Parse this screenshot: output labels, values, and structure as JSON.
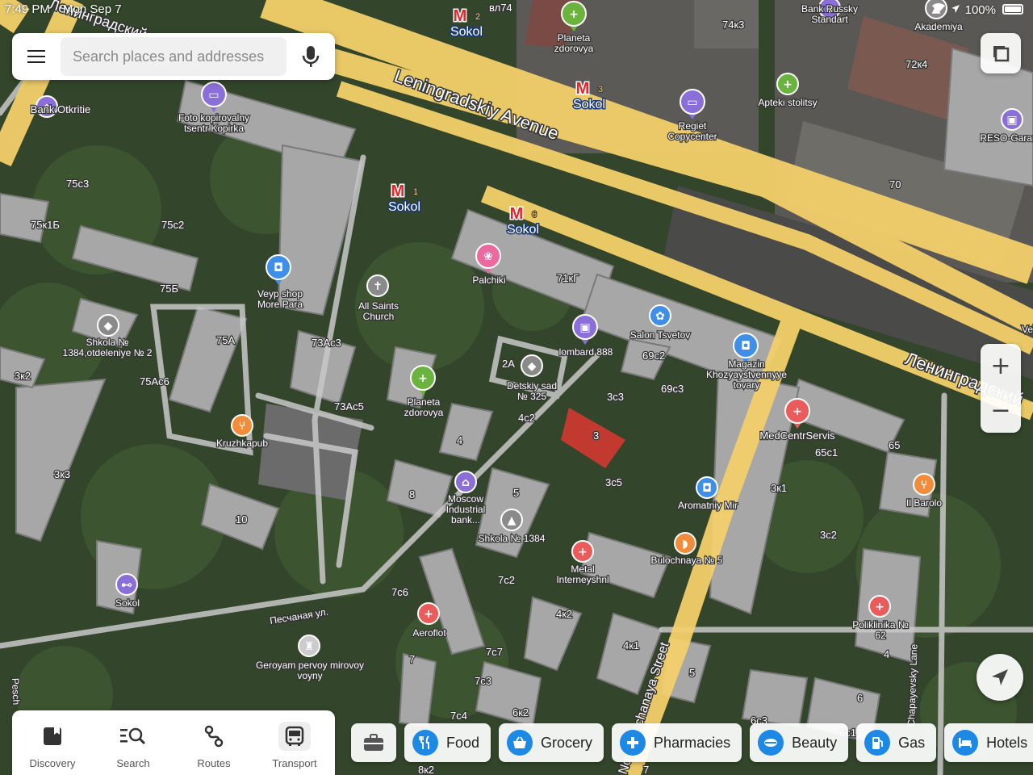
{
  "status": {
    "time": "7:49 PM",
    "date": "Mon Sep 7",
    "battery": "100%"
  },
  "search": {
    "placeholder": "Search places and addresses"
  },
  "zoom": {
    "in": "+",
    "out": "−"
  },
  "tabs": [
    {
      "label": "Discovery",
      "icon": "bookmark-icon"
    },
    {
      "label": "Search",
      "icon": "search-list-icon"
    },
    {
      "label": "Routes",
      "icon": "routes-icon"
    },
    {
      "label": "Transport",
      "icon": "bus-icon"
    }
  ],
  "chips": [
    {
      "label": "Food",
      "icon": "fork-knife-icon"
    },
    {
      "label": "Grocery",
      "icon": "basket-icon"
    },
    {
      "label": "Pharmacies",
      "icon": "cross-icon"
    },
    {
      "label": "Beauty",
      "icon": "beauty-icon"
    },
    {
      "label": "Gas",
      "icon": "fuel-icon"
    },
    {
      "label": "Hotels",
      "icon": "bed-icon"
    }
  ],
  "colors": {
    "major_road": "#f3cf6a",
    "minor_road": "#cfcfcf",
    "metro": "#e3262c",
    "poi_pharmacy": "#6bb33f",
    "poi_service": "#8a6fd8",
    "poi_shop": "#3f8fe8",
    "poi_food": "#f08c3a",
    "poi_medical": "#ea5b5b",
    "poi_beauty": "#ea6aa0",
    "chip_accent": "#1e88e5"
  },
  "streets": {
    "leningradsky_en": "Leningradskiy Avenue",
    "leningradsky_ru": "Ленинградский",
    "leningradsky_ru_top": "Ленинградский",
    "peschanaya_ru": "Песчаная ул.",
    "peschanaya_left": "Pesch",
    "novopeschanaya": "Novopeschanaya Street",
    "chapaevsky": "Chapayevsky Lane",
    "right_edge": "Ve"
  },
  "metro": [
    {
      "name": "Sokol",
      "exit": "2"
    },
    {
      "name": "Sokol",
      "exit": "3"
    },
    {
      "name": "Sokol",
      "exit": "1"
    },
    {
      "name": "Sokol",
      "exit": "6"
    }
  ],
  "pois": [
    {
      "name": "Bank Otkritie",
      "icon": "bank-icon"
    },
    {
      "name": "Foto kopirovalny tsentr Kopirka",
      "icon": "printer-icon"
    },
    {
      "name": "Planeta zdorovya",
      "icon": "pharmacy-icon"
    },
    {
      "name": "Regiet Copycenter",
      "icon": "printer-icon"
    },
    {
      "name": "Apteki stolitsy",
      "icon": "pharmacy-icon"
    },
    {
      "name": "Bank Russky Standart",
      "icon": "bank-icon"
    },
    {
      "name": "Akademiya",
      "icon": "school-icon"
    },
    {
      "name": "RESO-Garan",
      "icon": "briefcase-icon"
    },
    {
      "name": "Veyp shop More Para",
      "icon": "shopping-bag-icon"
    },
    {
      "name": "Palchiki",
      "icon": "beauty-icon"
    },
    {
      "name": "All Saints Church",
      "icon": "church-icon"
    },
    {
      "name": "Shkola № 1384,otdeleniye № 2",
      "icon": "kindergarten-icon"
    },
    {
      "name": "lombard 888",
      "icon": "briefcase-icon"
    },
    {
      "name": "Salon Tsvetov",
      "icon": "flower-icon"
    },
    {
      "name": "Magazin Khozyaystvennyye tovary",
      "icon": "shopping-bag-icon"
    },
    {
      "name": "Planeta zdorovya",
      "icon": "pharmacy-icon"
    },
    {
      "name": "Detskiy sad № 325",
      "icon": "kindergarten-icon"
    },
    {
      "name": "MedCentrServis",
      "icon": "medical-icon"
    },
    {
      "name": "Kruzhkapub",
      "icon": "food-icon"
    },
    {
      "name": "Moscow Industrial bank...",
      "icon": "bank-icon"
    },
    {
      "name": "Shkola № 1384",
      "icon": "school-icon"
    },
    {
      "name": "Aromatniy Mir",
      "icon": "shopping-bag-icon"
    },
    {
      "name": "Il Barolo",
      "icon": "food-icon"
    },
    {
      "name": "Bulochnaya № 5",
      "icon": "bakery-icon"
    },
    {
      "name": "Metal Interneyshnl",
      "icon": "medical-icon"
    },
    {
      "name": "Poliklinika № 62",
      "icon": "medical-icon"
    },
    {
      "name": "Sokol",
      "icon": "fitness-icon"
    },
    {
      "name": "Aeroflot",
      "icon": "medical-icon"
    },
    {
      "name": "Geroyam pervoy mirovoy voyny",
      "icon": "monument-icon"
    }
  ],
  "house_numbers": [
    "74к3",
    "72к4",
    "70",
    "75с3",
    "75к1Б",
    "75с2",
    "75Б",
    "75А",
    "73Ас3",
    "73Ас5",
    "75Ас6",
    "3к2",
    "3к3",
    "10",
    "71кГ",
    "69с2",
    "69с3",
    "2А",
    "3с3",
    "4с2",
    "3",
    "3с5",
    "4",
    "8",
    "5",
    "65",
    "65с1",
    "3к1",
    "3с2",
    "7с2",
    "7с6",
    "4к2",
    "4к1",
    "7с7",
    "7с3",
    "7с4",
    "6к2",
    "8к2",
    "7",
    "5",
    "6",
    "6с3",
    "4",
    "6с1",
    "7",
    "вл74"
  ]
}
